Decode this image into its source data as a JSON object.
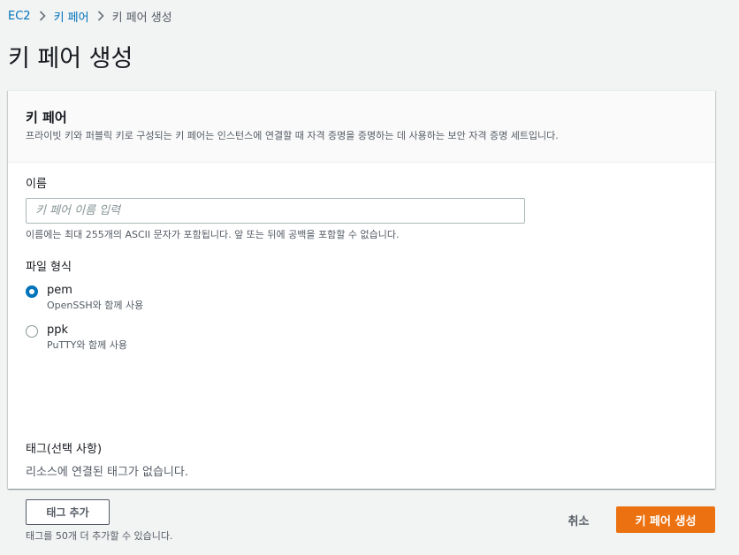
{
  "breadcrumb": {
    "items": [
      "EC2",
      "키 페어",
      "키 페어 생성"
    ]
  },
  "page": {
    "title": "키 페어 생성"
  },
  "panel": {
    "title": "키 페어",
    "description": "프라이빗 키와 퍼블릭 키로 구성되는 키 페어는 인스턴스에 연결할 때 자격 증명을 증명하는 데 사용하는 보안 자격 증명 세트입니다."
  },
  "name_field": {
    "label": "이름",
    "value": "",
    "placeholder": "키 페어 이름 입력",
    "hint": "이름에는 최대 255개의 ASCII 문자가 포함됩니다. 앞 또는 뒤에 공백을 포함할 수 없습니다."
  },
  "file_format": {
    "label": "파일 형식",
    "selected": "pem",
    "options": [
      {
        "value": "pem",
        "label": "pem",
        "description": "OpenSSH와 함께 사용"
      },
      {
        "value": "ppk",
        "label": "ppk",
        "description": "PuTTY와 함께 사용"
      }
    ]
  },
  "tags": {
    "label": "태그(선택 사항)",
    "empty_text": "리소스에 연결된 태그가 없습니다.",
    "add_button": "태그 추가",
    "hint": "태그를 50개 더 추가할 수 있습니다."
  },
  "footer": {
    "cancel_label": "취소",
    "submit_label": "키 페어 생성"
  },
  "colors": {
    "link": "#0073bb",
    "primary": "#ec7211",
    "radio_selected": "#0073bb",
    "background": "#f2f3f3"
  },
  "icons": {
    "breadcrumb_separator": "chevron-right-icon"
  }
}
